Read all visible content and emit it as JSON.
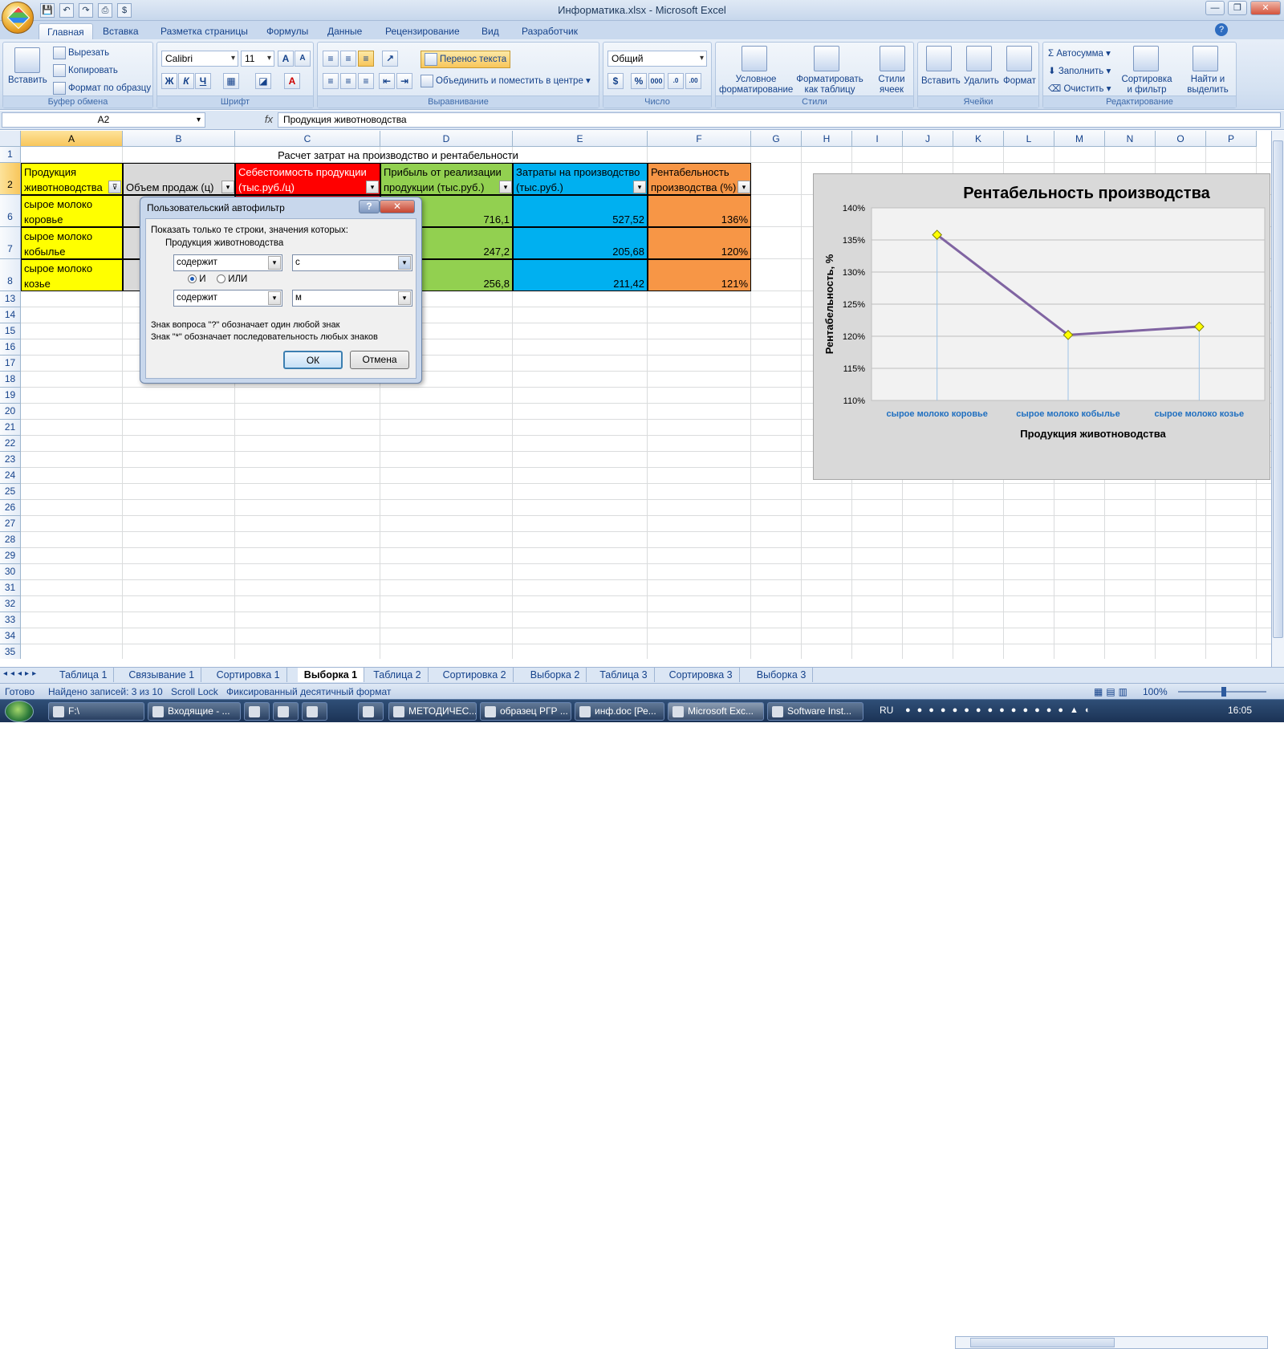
{
  "window": {
    "title": "Информатика.xlsx - Microsoft Excel"
  },
  "ribbon_tabs": [
    "Главная",
    "Вставка",
    "Разметка страницы",
    "Формулы",
    "Данные",
    "Рецензирование",
    "Вид",
    "Разработчик"
  ],
  "clipboard": {
    "paste": "Вставить",
    "cut": "Вырезать",
    "copy": "Копировать",
    "format_painter": "Формат по образцу",
    "label": "Буфер обмена"
  },
  "font": {
    "name": "Calibri",
    "size": "11",
    "bold": "Ж",
    "italic": "К",
    "underline": "Ч",
    "label": "Шрифт"
  },
  "alignment": {
    "wrap": "Перенос текста",
    "merge": "Объединить и поместить в центре",
    "label": "Выравнивание"
  },
  "number": {
    "format": "Общий",
    "label": "Число"
  },
  "styles": {
    "conditional": "Условное форматирование",
    "as_table": "Форматировать как таблицу",
    "cell_styles": "Стили ячеек",
    "label": "Стили"
  },
  "cells": {
    "insert": "Вставить",
    "delete": "Удалить",
    "format": "Формат",
    "label": "Ячейки"
  },
  "editing": {
    "autosum": "Автосумма",
    "fill": "Заполнить",
    "clear": "Очистить",
    "sort": "Сортировка и фильтр",
    "find": "Найти и выделить",
    "label": "Редактирование"
  },
  "formula_bar": {
    "name_box": "A2",
    "fx": "fx",
    "content": "Продукция животноводства"
  },
  "columns": [
    "A",
    "B",
    "C",
    "D",
    "E",
    "F",
    "G",
    "H",
    "I",
    "J",
    "K",
    "L",
    "M",
    "N",
    "O",
    "P"
  ],
  "rows": [
    "1",
    "2",
    "6",
    "7",
    "8",
    "13",
    "14",
    "15",
    "16",
    "17",
    "18",
    "19",
    "20",
    "21",
    "22",
    "23",
    "24",
    "25",
    "26",
    "27",
    "28",
    "29",
    "30",
    "31",
    "32",
    "33",
    "34",
    "35"
  ],
  "sheet": {
    "title": "Расчет затрат на производство и рентабельности",
    "headers": [
      "Продукция животноводства",
      "Объем продаж (ц)",
      "Себестоимость продукции (тыс.руб./ц)",
      "Прибыль от реализации продукции (тыс.руб.)",
      "Затраты на производство (тыс.руб.)",
      "Рентабельность производства (%)"
    ],
    "data": [
      {
        "product": "сырое молоко коровье",
        "profit": "716,1",
        "costs": "527,52",
        "rent": "136%"
      },
      {
        "product": "сырое молоко кобылье",
        "profit": "247,2",
        "costs": "205,68",
        "rent": "120%"
      },
      {
        "product": "сырое молоко козье",
        "profit": "256,8",
        "costs": "211,42",
        "rent": "121%"
      }
    ]
  },
  "dialog": {
    "title": "Пользовательский автофильтр",
    "help_btn": "?",
    "close_btn": "✕",
    "prompt": "Показать только те строки, значения которых:",
    "field": "Продукция животноводства",
    "op1": "содержит",
    "val1": "с",
    "and": "И",
    "or": "ИЛИ",
    "op2": "содержит",
    "val2": "м",
    "hint1": "Знак вопроса \"?\" обозначает один любой знак",
    "hint2": "Знак \"*\" обозначает последовательность любых знаков",
    "ok": "ОК",
    "cancel": "Отмена"
  },
  "chart_data": {
    "type": "line",
    "title": "Рентабельность производства",
    "xlabel": "Продукция животноводства",
    "ylabel": "Рентабельность, %",
    "categories": [
      "сырое молоко  коровье",
      "сырое молоко  кобылье",
      "сырое молоко  козье"
    ],
    "values": [
      135.8,
      120.2,
      121.5
    ],
    "ylim": [
      110,
      140
    ],
    "yticks": [
      "110%",
      "115%",
      "120%",
      "125%",
      "130%",
      "135%",
      "140%"
    ],
    "line_color": "#8064a2",
    "marker_color": "#ffff00"
  },
  "sheet_tabs": [
    "Таблица 1",
    "Связывание 1",
    "Сортировка 1",
    "Выборка 1",
    "Таблица 2",
    "Сортировка 2",
    "Выборка 2",
    "Таблица 3",
    "Сортировка 3",
    "Выборка 3"
  ],
  "active_sheet": "Выборка 1",
  "status": {
    "ready": "Готово",
    "found": "Найдено записей: 3 из 10",
    "scroll": "Scroll Lock",
    "fixed": "Фиксированный десятичный формат",
    "zoom": "100%"
  },
  "taskbar": {
    "items": [
      "F:\\",
      "Входящие - ...",
      "",
      "",
      "МЕТОДИЧЕС...",
      "образец РГР ...",
      "инф.doc [Ре...",
      "Microsoft Exc...",
      "Software Inst..."
    ],
    "lang": "RU",
    "time": "16:05"
  }
}
